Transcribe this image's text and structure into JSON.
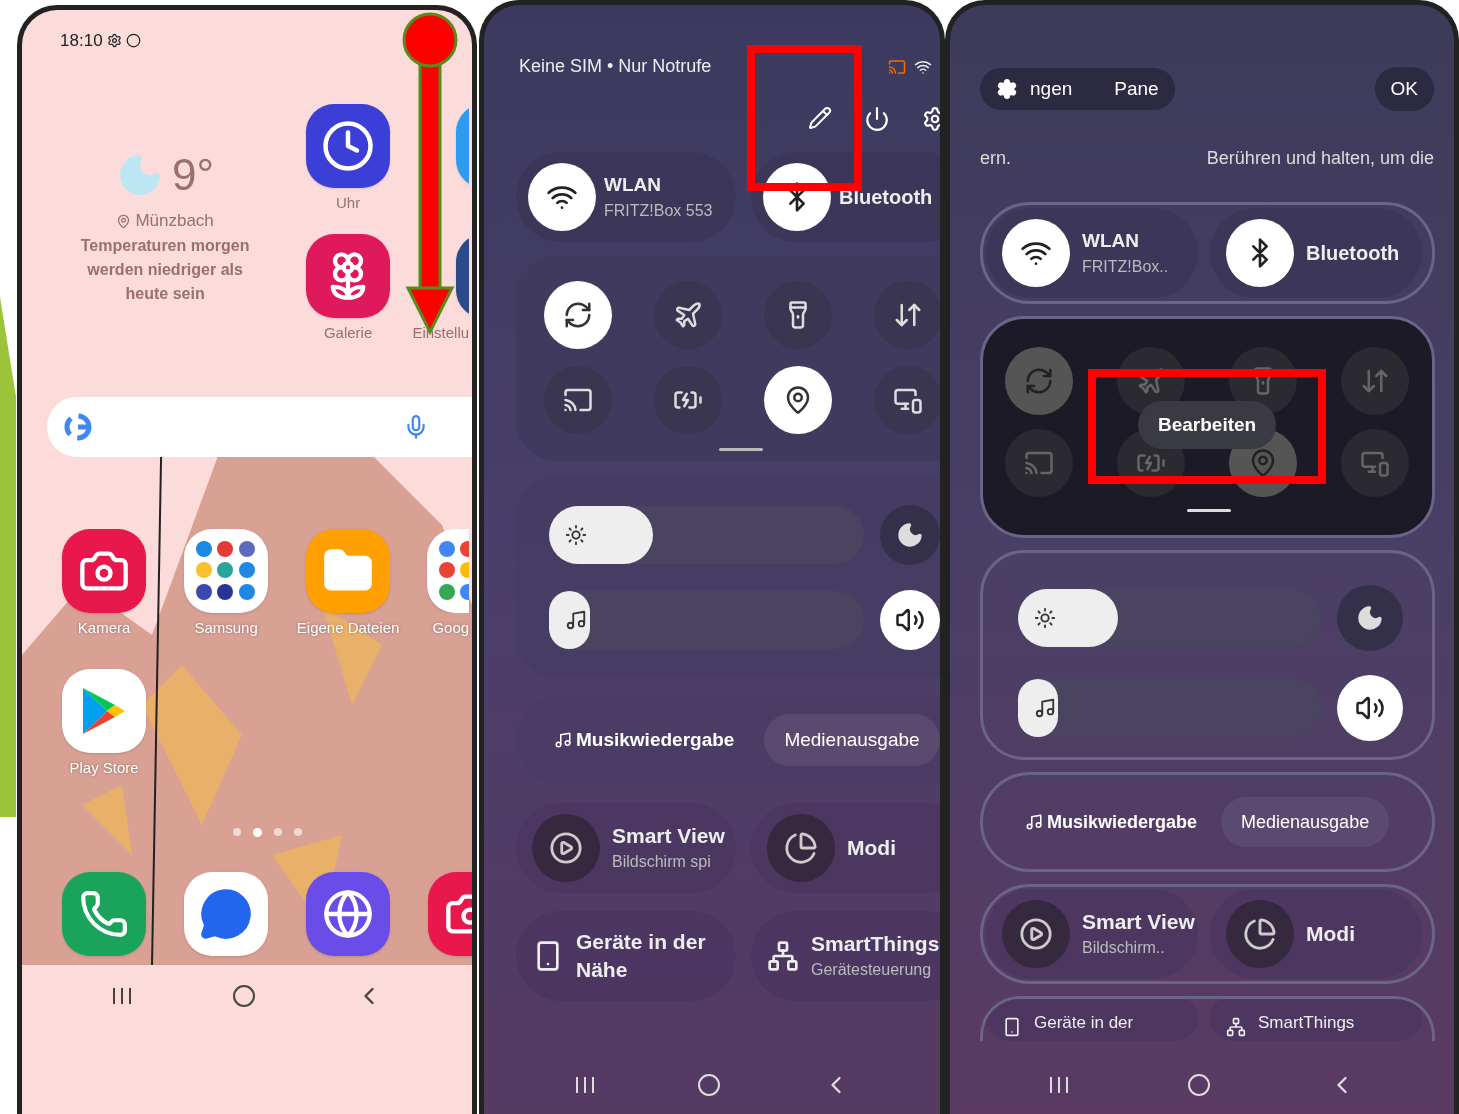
{
  "home": {
    "status_time": "18:10",
    "weather": {
      "temperature": "9°",
      "location": "Münzbach",
      "message": "Temperaturen morgen werden niedriger als heute sein"
    },
    "apps": [
      {
        "kind": "clock",
        "label": "Uhr"
      },
      {
        "kind": "chart"
      },
      {
        "kind": "gallery",
        "label": "Galerie"
      },
      {
        "kind": "settings",
        "label": "Einstellu"
      },
      {
        "kind": "camera",
        "label": "Kamera"
      },
      {
        "kind": "folder-samsung",
        "label": "Samsung"
      },
      {
        "kind": "files",
        "label": "Eigene Dateien"
      },
      {
        "kind": "folder-google",
        "label": "Goog"
      },
      {
        "kind": "play",
        "label": "Play Store"
      }
    ],
    "page_dots": [
      {
        "selected": false
      },
      {
        "selected": true
      },
      {
        "selected": false
      },
      {
        "selected": false
      }
    ],
    "dock": [
      {
        "kind": "phone"
      },
      {
        "kind": "messages"
      },
      {
        "kind": "internet"
      },
      {
        "kind": "camera"
      }
    ]
  },
  "quick_panel": {
    "status": "Keine SIM • Nur Notrufe",
    "tiles": [
      {
        "kind": "wifi",
        "title": "WLAN",
        "subtitle": "FRITZ!Box 553",
        "on": true
      },
      {
        "kind": "bluetooth",
        "title": "Bluetooth",
        "on": true
      }
    ],
    "toggles": [
      {
        "kind": "rotate",
        "on": true
      },
      {
        "kind": "airplane",
        "on": false
      },
      {
        "kind": "flashlight",
        "on": false
      },
      {
        "kind": "data",
        "on": false
      },
      {
        "kind": "cast",
        "on": false
      },
      {
        "kind": "battery",
        "on": false
      },
      {
        "kind": "location",
        "on": true
      },
      {
        "kind": "device",
        "on": false
      }
    ],
    "brightness": {
      "level": 0.33
    },
    "volume": {
      "level": 0.13
    },
    "media": [
      "Musikwiedergabe",
      "Medienausgabe"
    ],
    "shortcuts": [
      {
        "kind": "smart-view",
        "title": "Smart View",
        "subtitle": "Bildschirm spi"
      },
      {
        "kind": "modes",
        "title": "Modi"
      },
      {
        "kind": "nearby",
        "title": "Geräte in der Nähe"
      },
      {
        "kind": "smartthings",
        "title": "SmartThings",
        "subtitle": "Gerätesteuerung"
      }
    ]
  },
  "edit_panel": {
    "tabs": [
      "ngen",
      "Pane"
    ],
    "ok": "OK",
    "hints": [
      "ern.",
      "Berühren und halten, um die"
    ],
    "tiles": [
      {
        "kind": "wifi",
        "title": "WLAN",
        "subtitle": "FRITZ!Box..",
        "on": true
      },
      {
        "kind": "bluetooth",
        "title": "Bluetooth",
        "on": true
      }
    ],
    "toggles": [
      {
        "kind": "rotate",
        "on": true
      },
      {
        "kind": "airplane",
        "on": false
      },
      {
        "kind": "flashlight",
        "on": false
      },
      {
        "kind": "data",
        "on": false
      },
      {
        "kind": "cast",
        "on": false
      },
      {
        "kind": "battery",
        "on": false
      },
      {
        "kind": "location",
        "on": true
      },
      {
        "kind": "device",
        "on": false
      }
    ],
    "popup": "Bearbeiten",
    "brightness": {
      "level": 0.33
    },
    "volume": {
      "level": 0.08
    },
    "media": [
      "Musikwiedergabe",
      "Medienausgabe"
    ],
    "shortcuts": [
      {
        "kind": "smart-view",
        "title": "Smart View",
        "subtitle": "Bildschirm.."
      },
      {
        "kind": "modes",
        "title": "Modi"
      },
      {
        "kind": "nearby",
        "title": "Geräte in der"
      },
      {
        "kind": "smartthings",
        "title": "SmartThings"
      }
    ]
  }
}
